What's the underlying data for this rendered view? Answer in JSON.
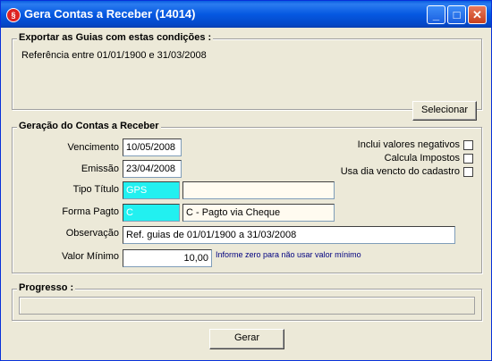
{
  "window": {
    "title": "Gera Contas a Receber (14014)"
  },
  "export_group": {
    "title": "Exportar as Guias com estas condições :",
    "condition_text": "Referência entre 01/01/1900 e 31/03/2008",
    "select_button": "Selecionar"
  },
  "generation_group": {
    "title": "Geração do Contas a Receber",
    "vencimento": {
      "label": "Vencimento",
      "value": "10/05/2008"
    },
    "emissao": {
      "label": "Emissão",
      "value": "23/04/2008"
    },
    "tipo_titulo": {
      "label": "Tipo Título",
      "code": "GPS",
      "description": ""
    },
    "forma_pagto": {
      "label": "Forma Pagto",
      "code": "C",
      "description": "C - Pagto via Cheque"
    },
    "observacao": {
      "label": "Observação",
      "value": "Ref. guias de 01/01/1900 a 31/03/2008"
    },
    "valor_minimo": {
      "label": "Valor Mínimo",
      "value": "10,00",
      "hint": "Informe zero para não usar valor mínimo"
    },
    "checkboxes": [
      {
        "label": "Inclui valores negativos",
        "checked": false
      },
      {
        "label": "Calcula Impostos",
        "checked": false
      },
      {
        "label": "Usa dia vencto do cadastro",
        "checked": false
      }
    ]
  },
  "progress_group": {
    "title": "Progresso :",
    "value": 0
  },
  "actions": {
    "generate_button": "Gerar"
  }
}
